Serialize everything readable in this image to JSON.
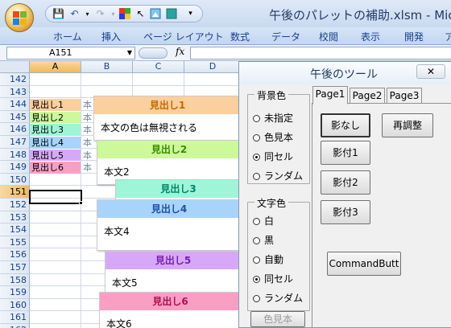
{
  "window": {
    "title": "午後のパレットの補助.xlsm - Micros"
  },
  "ribbon_tabs": [
    "ホーム",
    "挿入",
    "ページ レイアウト",
    "数式",
    "データ",
    "校閲",
    "表示",
    "開発",
    "ア"
  ],
  "formula_bar": {
    "name_box": "A151",
    "fx_label": "fx",
    "formula": ""
  },
  "columns": [
    "A",
    "B",
    "C",
    "D"
  ],
  "selected_column": "A",
  "rows": [
    "142",
    "143",
    "144",
    "145",
    "146",
    "147",
    "148",
    "149",
    "150",
    "151",
    "152",
    "153",
    "154",
    "155",
    "156",
    "157",
    "158",
    "159",
    "160",
    "161",
    "162"
  ],
  "selected_row": "151",
  "col_a_cells": [
    {
      "text": "見出し1",
      "bg": "#fbcf9e"
    },
    {
      "text": "見出し2",
      "bg": "#ccf99a"
    },
    {
      "text": "見出し3",
      "bg": "#9ef5d8"
    },
    {
      "text": "見出し4",
      "bg": "#a8d4fb"
    },
    {
      "text": "見出し5",
      "bg": "#d7a8f8"
    },
    {
      "text": "見出し6",
      "bg": "#fa9fc4"
    }
  ],
  "col_b_cells": [
    "本文",
    "本文",
    "本文",
    "本文",
    "本文",
    "本文"
  ],
  "shapes": [
    {
      "heading": "見出し1",
      "body": "本文の色は無視される",
      "color": "#fbcf9e",
      "text_color": "#c76a00"
    },
    {
      "heading": "見出し2",
      "body": "本文2",
      "color": "#ccf99a",
      "text_color": "#3a8a00"
    },
    {
      "heading": "見出し3",
      "body": "",
      "color": "#9ef5d8",
      "text_color": "#00866a"
    },
    {
      "heading": "見出し4",
      "body": "本文4",
      "color": "#a8d4fb",
      "text_color": "#1f4fa8"
    },
    {
      "heading": "見出し5",
      "body": "本文5",
      "color": "#d7a8f8",
      "text_color": "#7a1fb0"
    },
    {
      "heading": "見出し6",
      "body": "本文6",
      "color": "#fa9fc4",
      "text_color": "#b0104f"
    }
  ],
  "dialog": {
    "title": "午後のツール",
    "close": "✕",
    "bg_frame": {
      "caption": "背景色",
      "options": [
        "未指定",
        "色見本",
        "同セル",
        "ランダム"
      ],
      "selected": "同セル"
    },
    "fg_frame": {
      "caption": "文字色",
      "options": [
        "白",
        "黒",
        "自動",
        "同セル",
        "ランダム"
      ],
      "selected": "同セル"
    },
    "bottom_button": "色見本",
    "tabs": [
      "Page1",
      "Page2",
      "Page3"
    ],
    "active_tab": "Page1",
    "buttons": {
      "no_shadow": "影なし",
      "readjust": "再調整",
      "shadow1": "影付1",
      "shadow2": "影付2",
      "shadow3": "影付3",
      "command": "CommandButt"
    }
  }
}
